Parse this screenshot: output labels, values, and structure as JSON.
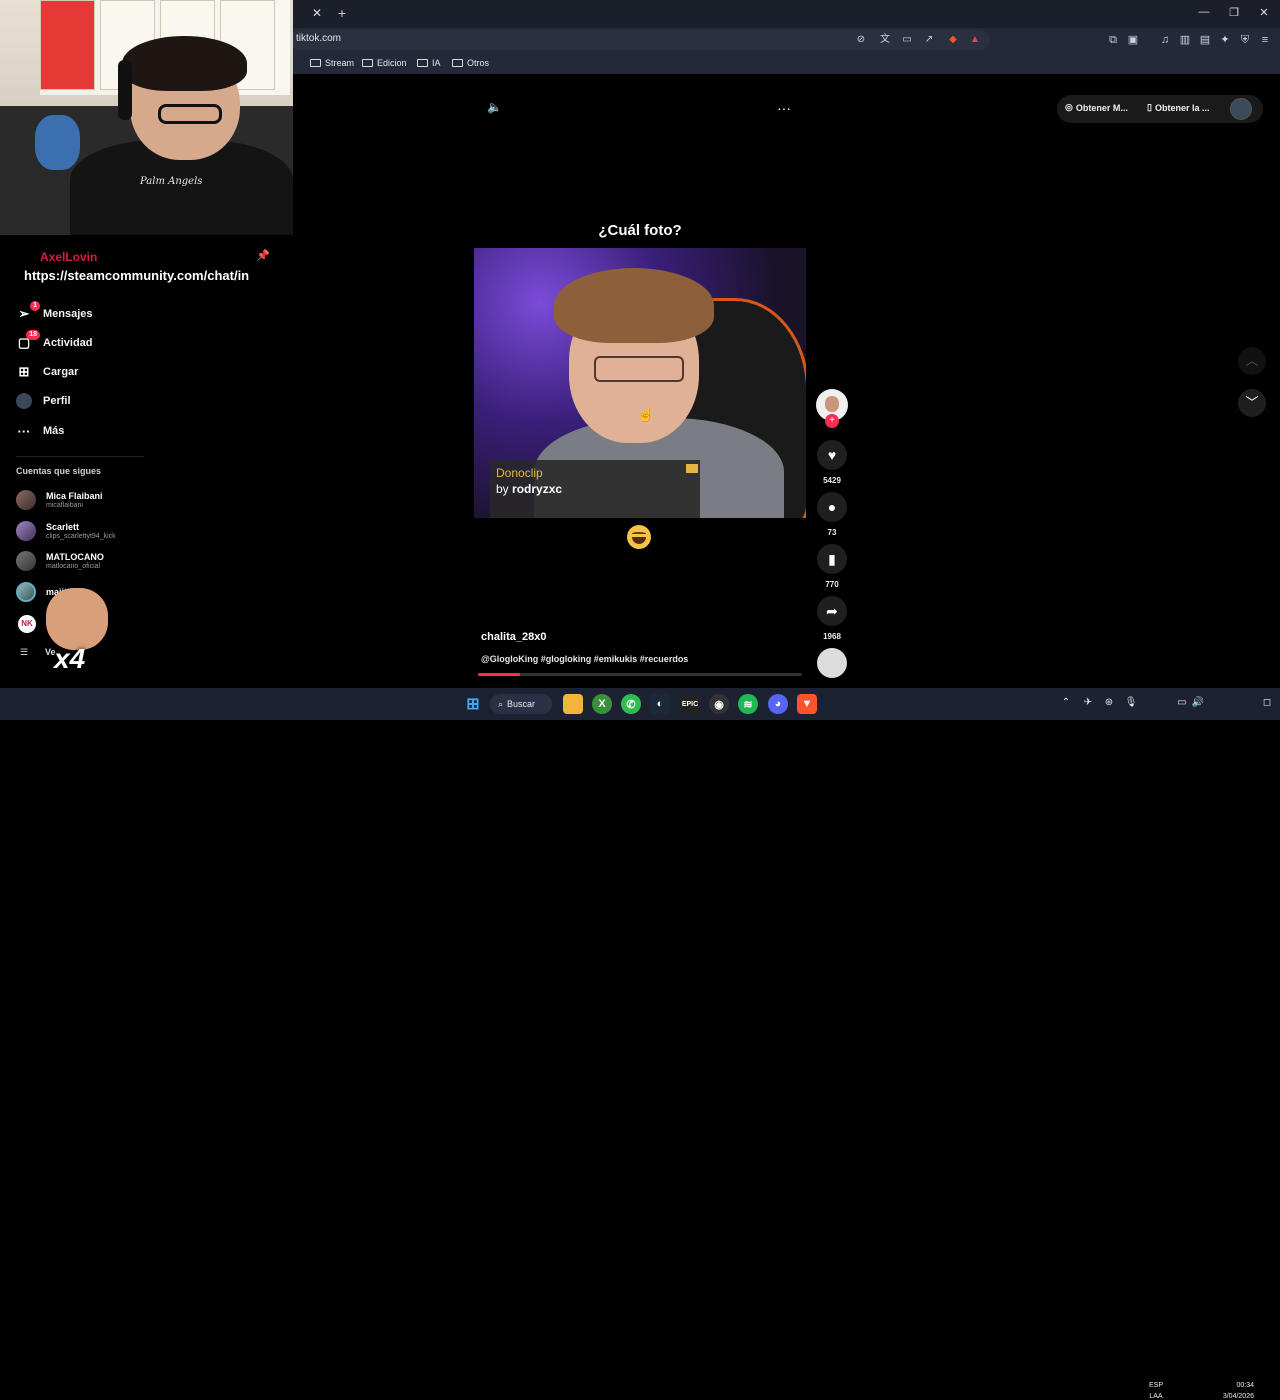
{
  "browser": {
    "url": "tiktok.com",
    "bookmarks": [
      {
        "label": "Stream"
      },
      {
        "label": "Edicion"
      },
      {
        "label": "IA"
      },
      {
        "label": "Otros"
      }
    ]
  },
  "webcam": {
    "shirt_text": "Palm Angels"
  },
  "sidebar": {
    "streamer_name": "AxelLovin",
    "pinned_message": "https://steamcommunity.com/chat/in",
    "nav": [
      {
        "label": "Mensajes",
        "badge": "1"
      },
      {
        "label": "Actividad",
        "badge": "18"
      },
      {
        "label": "Cargar"
      },
      {
        "label": "Perfil"
      },
      {
        "label": "Más"
      }
    ],
    "following_title": "Cuentas que sigues",
    "following": [
      {
        "name": "Mica Flaibani",
        "handle": "micaflaibani"
      },
      {
        "name": "Scarlett",
        "handle": "clips_scarlettyt94_kick"
      },
      {
        "name": "MATLOCANO",
        "handle": "matlocano_oficial"
      },
      {
        "name": "maiitosl",
        "handle": ""
      }
    ],
    "see_more": "Ve",
    "emote_text": "x4"
  },
  "video": {
    "caption": "¿Cuál foto?",
    "overlay_line1": "Donoclip",
    "overlay_by": "by",
    "overlay_user": "rodryzxc",
    "author": "chalita_28x0",
    "hashtags": "@GlogloKing #glogloking #emikukis #recuerdos",
    "progress": 0.13
  },
  "actions": {
    "likes": "5429",
    "comments": "73",
    "saves": "770",
    "shares": "1968"
  },
  "top_right": {
    "pill1": "Obtener M...",
    "pill2": "Obtener la ..."
  },
  "taskbar": {
    "search_label": "Buscar",
    "lang_top": "ESP",
    "lang_bottom": "LAA",
    "time": "00:34",
    "date": "3/04/2026"
  },
  "colors": {
    "accent": "#fe2c55",
    "streamer_name": "#d81b3f",
    "donoclip": "#e8b544",
    "background": "#000000"
  },
  "icons": {
    "sound": "speaker-icon",
    "more": "ellipsis-icon",
    "like": "heart-icon",
    "comment": "comment-icon",
    "save": "bookmark-icon",
    "share": "share-icon"
  }
}
